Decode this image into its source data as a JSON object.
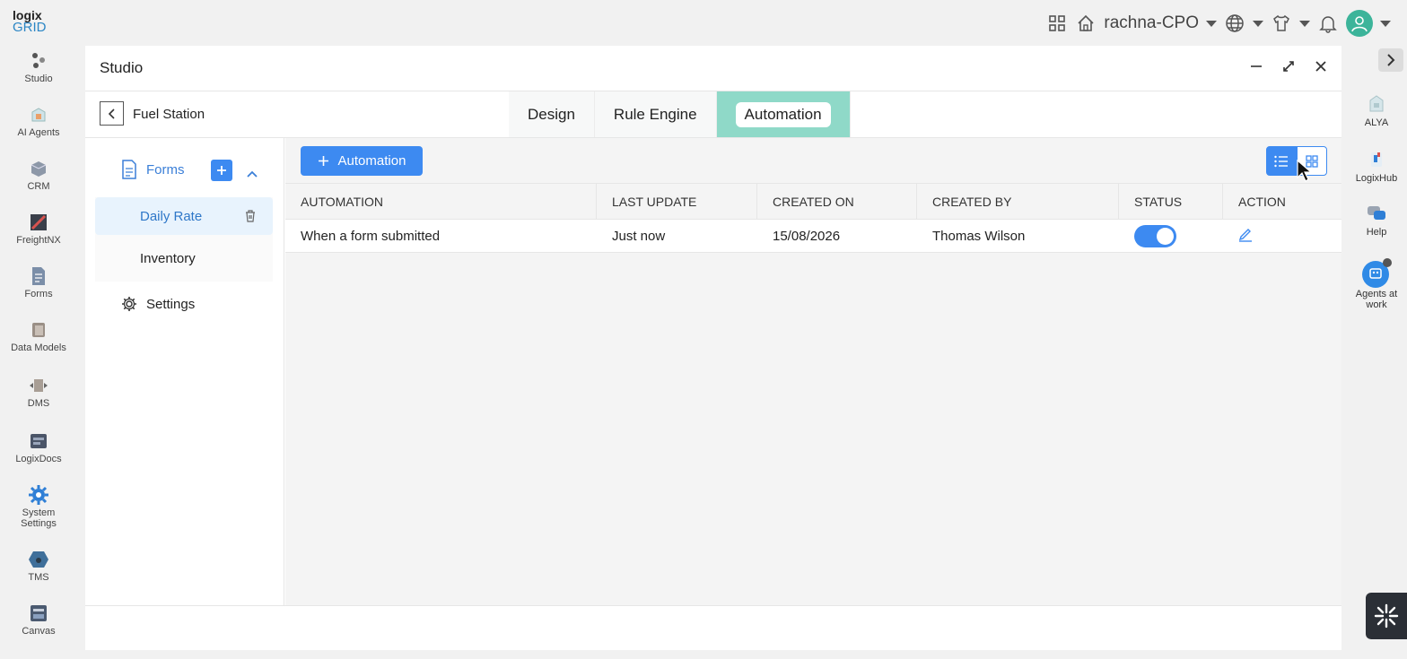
{
  "brand": {
    "line1": "logix",
    "line2": "GRID"
  },
  "topbar": {
    "tenant": "rachna-CPO"
  },
  "left_sidebar": [
    {
      "label": "Studio",
      "icon": "studio-icon"
    },
    {
      "label": "AI Agents",
      "icon": "ai-agents-icon"
    },
    {
      "label": "CRM",
      "icon": "crm-icon"
    },
    {
      "label": "FreightNX",
      "icon": "freightnx-icon"
    },
    {
      "label": "Forms",
      "icon": "forms-icon"
    },
    {
      "label": "Data Models",
      "icon": "data-models-icon"
    },
    {
      "label": "DMS",
      "icon": "dms-icon"
    },
    {
      "label": "LogixDocs",
      "icon": "logixdocs-icon"
    },
    {
      "label": "System Settings",
      "icon": "gear-icon"
    },
    {
      "label": "TMS",
      "icon": "tms-icon"
    },
    {
      "label": "Canvas",
      "icon": "canvas-icon"
    }
  ],
  "right_sidebar": [
    {
      "label": "ALYA",
      "icon": "alya-icon"
    },
    {
      "label": "LogixHub",
      "icon": "logixhub-icon"
    },
    {
      "label": "Help",
      "icon": "help-icon"
    },
    {
      "label": "Agents at work",
      "icon": "agents-at-work-icon"
    }
  ],
  "studio": {
    "title": "Studio",
    "app_name": "Fuel Station",
    "tabs": [
      {
        "label": "Design",
        "active": false
      },
      {
        "label": "Rule Engine",
        "active": false
      },
      {
        "label": "Automation",
        "active": true
      }
    ],
    "leftnav": {
      "forms_label": "Forms",
      "items": [
        {
          "label": "Daily Rate",
          "selected": true
        },
        {
          "label": "Inventory",
          "selected": false
        }
      ],
      "settings_label": "Settings"
    },
    "main": {
      "add_button_label": "Automation",
      "columns": [
        "AUTOMATION",
        "LAST UPDATE",
        "CREATED ON",
        "CREATED BY",
        "STATUS",
        "ACTION"
      ],
      "rows": [
        {
          "automation": "When a form submitted",
          "last_update": "Just now",
          "created_on": "15/08/2026",
          "created_by": "Thomas Wilson",
          "status_on": true
        }
      ]
    }
  },
  "colors": {
    "accent": "#3d8af1",
    "active_tab": "#8fd9c8",
    "selected_nav": "#e8f3fd"
  }
}
